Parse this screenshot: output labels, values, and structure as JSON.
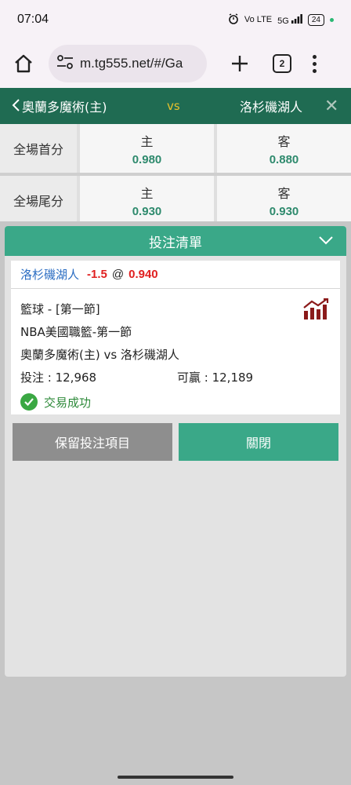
{
  "status_bar": {
    "time": "07:04",
    "network_label": "Vo LTE",
    "signal_label": "5G",
    "battery": "24"
  },
  "browser": {
    "url": "m.tg555.net/#/Ga",
    "tab_count": "2"
  },
  "match": {
    "home_team": "奧蘭多魔術(主)",
    "vs": "vs",
    "away_team": "洛杉磯湖人",
    "close_symbol": "✕"
  },
  "odds_table": {
    "rows": [
      {
        "label": "全場首分",
        "home_side": "主",
        "home_price": "0.980",
        "away_side": "客",
        "away_price": "0.880"
      },
      {
        "label": "全場尾分",
        "home_side": "主",
        "home_price": "0.930",
        "away_side": "客",
        "away_price": "0.930"
      }
    ]
  },
  "bet_slip": {
    "title": "投注清單",
    "selection": {
      "team": "洛杉磯湖人",
      "handicap": "-1.5",
      "at": "@",
      "odds": "0.940"
    },
    "details": {
      "sport_period": "籃球 - [第一節]",
      "league": "NBA美國職籃-第一節",
      "matchup": "奧蘭多魔術(主) vs 洛杉磯湖人",
      "stake_label": "投注 : 12,968",
      "win_label": "可贏 : 12,189",
      "status": "交易成功"
    },
    "buttons": {
      "keep": "保留投注項目",
      "close": "關閉"
    }
  },
  "colors": {
    "header_green": "#1f6b52",
    "accent_green": "#3aa888",
    "price_green": "#2e8a6d",
    "odds_red": "#e02020",
    "team_blue": "#2a6cc2",
    "vs_yellow": "#e7c12b"
  }
}
